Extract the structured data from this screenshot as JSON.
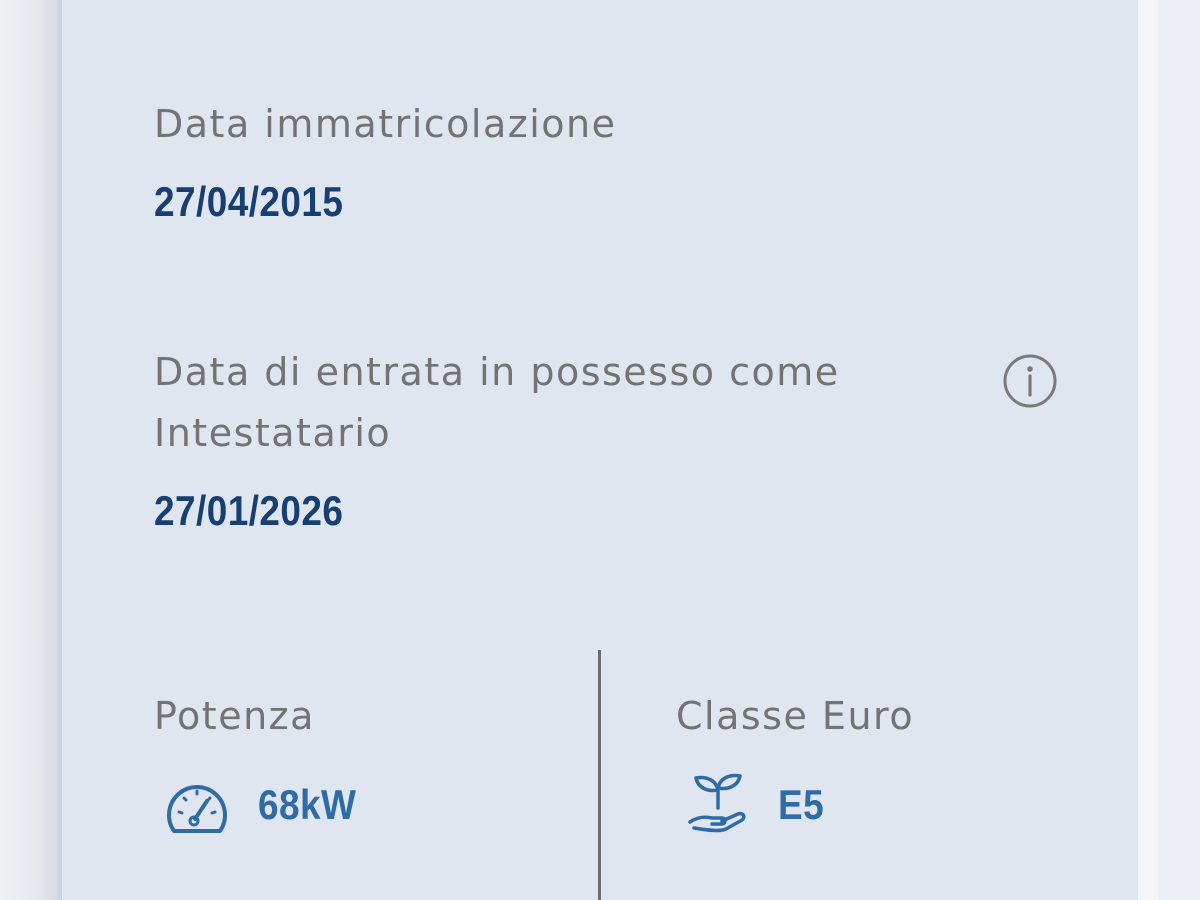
{
  "registration": {
    "label": "Data immatricolazione",
    "value": "27/04/2015"
  },
  "ownership": {
    "label_line1": "Data di entrata in possesso come",
    "label_line2": "Intestatario",
    "value": "27/01/2026",
    "info_icon": "info-icon"
  },
  "power": {
    "label": "Potenza",
    "value": "68kW",
    "icon": "speedometer-icon"
  },
  "euro_class": {
    "label": "Classe Euro",
    "value": "E5",
    "icon": "plant-hand-icon"
  },
  "colors": {
    "card_background": "#dfe6f0",
    "label_text": "#737373",
    "value_text": "#173f71",
    "accent": "#2f6ba5"
  }
}
